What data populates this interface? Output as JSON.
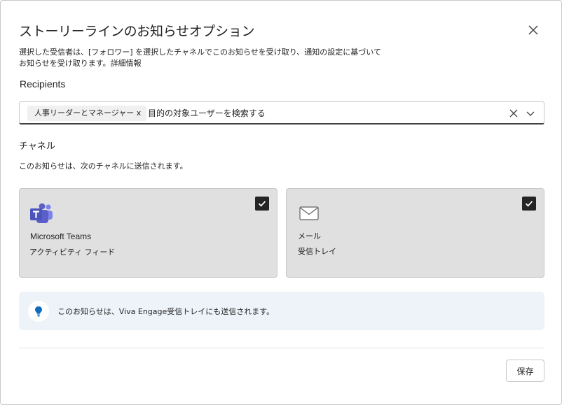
{
  "dialog": {
    "title": "ストーリーラインのお知らせオプション",
    "description": "選択した受信者は、[フォロワー] を選択したチャネルでこのお知らせを受け取り、通知の設定に基づいてお知らせを受け取ります。",
    "details_link": "詳細情報"
  },
  "recipients": {
    "label": "Recipients",
    "chip_label": "人事リーダーとマネージャー x",
    "search_placeholder": "目的の対象ユーザーを検索する"
  },
  "channels": {
    "heading": "チャネル",
    "description": "このお知らせは、次のチャネルに送信されます。",
    "items": [
      {
        "name": "Microsoft Teams",
        "sub": "アクティビティ フィード",
        "checked": true,
        "icon": "teams-icon"
      },
      {
        "name": "メール",
        "sub": "受信トレイ",
        "checked": true,
        "icon": "mail-icon"
      }
    ]
  },
  "info": {
    "text": "このお知らせは、Viva Engage受信トレイにも送信されます。",
    "icon": "lightbulb-icon",
    "icon_color": "#0f6cbd"
  },
  "footer": {
    "save_label": "保存"
  },
  "colors": {
    "card_bg": "#e0e0e0",
    "info_bg": "#eef3f9",
    "teams_purple": "#5b5fc7"
  }
}
